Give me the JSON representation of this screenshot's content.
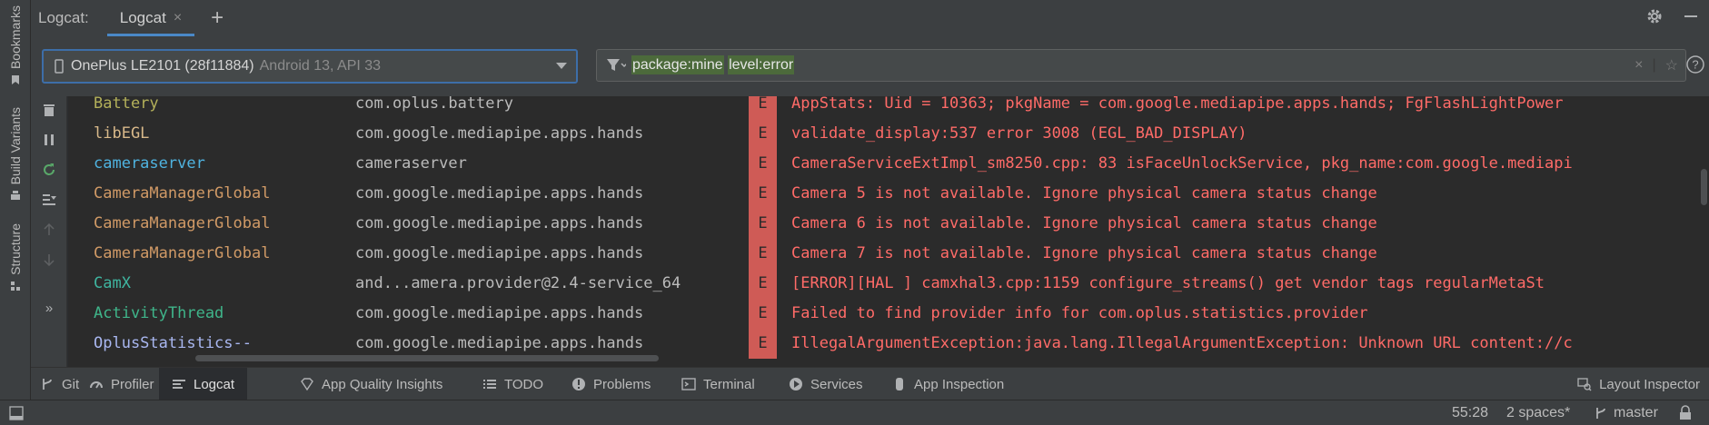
{
  "side_tabs": {
    "bookmarks": "Bookmarks",
    "build_variants": "Build Variants",
    "structure": "Structure"
  },
  "header": {
    "title": "Logcat:",
    "tab_label": "Logcat",
    "tab_close": "×",
    "add_tab": "+"
  },
  "toolbar": {
    "device_name": "OnePlus LE2101 (28f11884)",
    "device_api": "Android 13, API 33",
    "filter_term1": "package:mine",
    "filter_term2": "level:error",
    "clear": "×",
    "star": "☆",
    "help": "?"
  },
  "actions": {
    "more": "»"
  },
  "log_rows": [
    {
      "tag": "Battery",
      "tag_color": "#b3b05a",
      "package": "com.oplus.battery",
      "level": "E",
      "message": "AppStats: Uid = 10363; pkgName = com.google.mediapipe.apps.hands; FgFlashLightPower"
    },
    {
      "tag": "libEGL",
      "tag_color": "#d9b98a",
      "package": "com.google.mediapipe.apps.hands",
      "level": "E",
      "message": "validate_display:537 error 3008 (EGL_BAD_DISPLAY)"
    },
    {
      "tag": "cameraserver",
      "tag_color": "#4fb3e0",
      "package": "cameraserver",
      "level": "E",
      "message": "CameraServiceExtImpl_sm8250.cpp: 83 isFaceUnlockService, pkg_name:com.google.mediapi"
    },
    {
      "tag": "CameraManagerGlobal",
      "tag_color": "#d19a66",
      "package": "com.google.mediapipe.apps.hands",
      "level": "E",
      "message": "Camera 5 is not available. Ignore physical camera status change"
    },
    {
      "tag": "CameraManagerGlobal",
      "tag_color": "#d19a66",
      "package": "com.google.mediapipe.apps.hands",
      "level": "E",
      "message": "Camera 6 is not available. Ignore physical camera status change"
    },
    {
      "tag": "CameraManagerGlobal",
      "tag_color": "#d19a66",
      "package": "com.google.mediapipe.apps.hands",
      "level": "E",
      "message": "Camera 7 is not available. Ignore physical camera status change"
    },
    {
      "tag": "CamX",
      "tag_color": "#3fb5a0",
      "package": "and...amera.provider@2.4-service_64",
      "level": "E",
      "message": "[ERROR][HAL    ] camxhal3.cpp:1159 configure_streams() get vendor tags regularMetaSt"
    },
    {
      "tag": "ActivityThread",
      "tag_color": "#3fb58a",
      "package": "com.google.mediapipe.apps.hands",
      "level": "E",
      "message": "Failed to find provider info for com.oplus.statistics.provider"
    },
    {
      "tag": "OplusStatistics--",
      "tag_color": "#a9b7f0",
      "package": "com.google.mediapipe.apps.hands",
      "level": "E",
      "message": "IllegalArgumentException:java.lang.IllegalArgumentException: Unknown URL content://c"
    }
  ],
  "tool_windows": {
    "git": "Git",
    "profiler": "Profiler",
    "logcat": "Logcat",
    "app_quality": "App Quality Insights",
    "todo": "TODO",
    "problems": "Problems",
    "terminal": "Terminal",
    "services": "Services",
    "app_inspection": "App Inspection",
    "layout_inspector": "Layout Inspector"
  },
  "status_bar": {
    "position": "55:28",
    "indent": "2 spaces*",
    "branch": "master"
  },
  "colors": {
    "accent": "#4a88c7",
    "error_badge": "#cf5b56",
    "error_text": "#ff6b68",
    "filter_chip": "#4c6a3b"
  }
}
